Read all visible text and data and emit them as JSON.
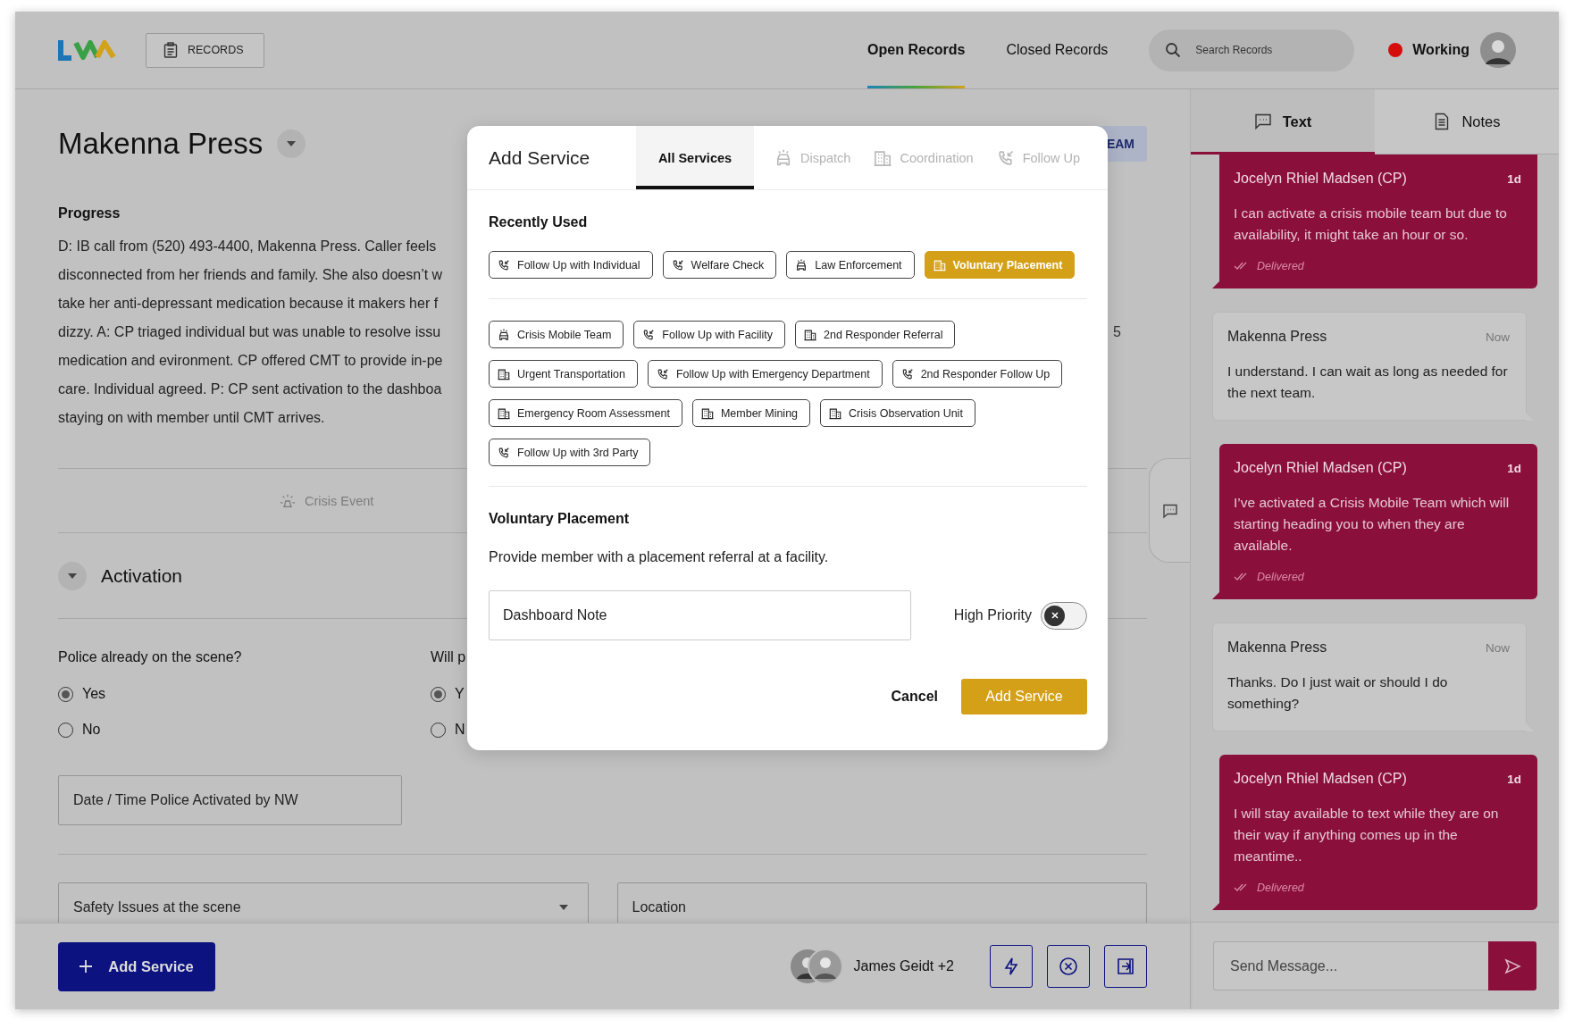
{
  "header": {
    "records_button": "RECORDS",
    "nav": [
      {
        "label": "Open Records",
        "selected": true
      },
      {
        "label": "Closed Records",
        "selected": false
      }
    ],
    "search": {
      "placeholder": "Search Records"
    },
    "status": "Working"
  },
  "record": {
    "title": "Makenna Press",
    "cut_button": "EAM",
    "progress": {
      "heading": "Progress",
      "lines": [
        "D: IB call from (520) 493-4400, Makenna Press. Caller feels",
        "disconnected from her friends and family. She also doesn’t w",
        "take her anti-depressant medication because it makers her f",
        "dizzy. A: CP triaged individual but was unable to resolve issu",
        "medication and evironment. CP offered CMT to provide in-pe",
        "care. Individual agreed. P:  CP sent activation to the dashboa",
        "staying on with member until CMT arrives."
      ],
      "fragment": "5"
    },
    "event_tab": "Crisis Event",
    "section": {
      "title": "Activation",
      "expanded": true
    },
    "questions": [
      {
        "label": "Police already on the scene?",
        "options": [
          {
            "label": "Yes",
            "selected": true
          },
          {
            "label": "No",
            "selected": false
          }
        ]
      },
      {
        "label": "Will p",
        "options": [
          {
            "label": "Y",
            "selected": true
          },
          {
            "label": "N",
            "selected": false
          }
        ]
      }
    ],
    "date_field": {
      "placeholder": "Date / Time Police Activated by NW"
    },
    "fields": [
      {
        "kind": "select",
        "placeholder": "Safety Issues at the scene"
      },
      {
        "kind": "text",
        "placeholder": "Location"
      }
    ]
  },
  "footer": {
    "add_button": "Add Service",
    "assignees": "James Geidt +2",
    "actions": [
      {
        "kind": "bolt"
      },
      {
        "kind": "cancel"
      },
      {
        "kind": "exit"
      }
    ]
  },
  "modal": {
    "title": "Add Service",
    "tabs": [
      {
        "label": "All Services",
        "selected": true
      },
      {
        "label": "Dispatch",
        "kind": "car",
        "selected": false
      },
      {
        "label": "Coordination",
        "kind": "building",
        "selected": false
      },
      {
        "label": "Follow Up",
        "kind": "phone",
        "selected": false
      }
    ],
    "recent_heading": "Recently Used",
    "recent": [
      {
        "label": "Follow Up with Individual",
        "kind": "phone",
        "selected": false
      },
      {
        "label": "Welfare Check",
        "kind": "phone",
        "selected": false
      },
      {
        "label": "Law Enforcement",
        "kind": "car",
        "selected": false
      },
      {
        "label": "Voluntary Placement",
        "kind": "building",
        "selected": true
      }
    ],
    "services": [
      {
        "label": "Crisis Mobile Team",
        "kind": "car",
        "selected": false
      },
      {
        "label": "Follow Up with Facility",
        "kind": "phone",
        "selected": false
      },
      {
        "label": "2nd Responder Referral",
        "kind": "building",
        "selected": false
      },
      {
        "label": "Urgent Transportation",
        "kind": "building",
        "selected": false
      },
      {
        "label": "Follow Up with Emergency Department",
        "kind": "phone",
        "selected": false
      },
      {
        "label": "2nd Responder Follow Up",
        "kind": "phone",
        "selected": false
      },
      {
        "label": "Emergency Room Assessment",
        "kind": "building",
        "selected": false
      },
      {
        "label": "Member Mining",
        "kind": "building",
        "selected": false
      },
      {
        "label": "Crisis Observation Unit",
        "kind": "building",
        "selected": false
      },
      {
        "label": "Follow Up with 3rd Party",
        "kind": "phone",
        "selected": false
      }
    ],
    "detail": {
      "title": "Voluntary Placement",
      "description": "Provide member with a placement referral at a facility.",
      "note": {
        "placeholder": "Dashboard Note"
      },
      "priority": {
        "label": "High Priority",
        "on": false
      }
    },
    "buttons": {
      "cancel": "Cancel",
      "confirm": "Add Service"
    }
  },
  "chat": {
    "tabs": [
      {
        "label": "Text",
        "kind": "chat",
        "selected": true
      },
      {
        "label": "Notes",
        "kind": "note",
        "selected": false
      }
    ],
    "messages": [
      {
        "kind": "agent",
        "sender": "Jocelyn Rhiel Madsen (CP)",
        "time": "1d",
        "text": "I can activate a crisis mobile team but due to availability, it might take an hour or so.",
        "status": "Delivered"
      },
      {
        "kind": "member",
        "sender": "Makenna Press",
        "time": "Now",
        "text": "I understand. I can wait as long as needed for the next team."
      },
      {
        "kind": "agent",
        "sender": "Jocelyn Rhiel Madsen (CP)",
        "time": "1d",
        "text": "I’ve activated a Crisis Mobile Team which will starting heading you to when they are available.",
        "status": "Delivered"
      },
      {
        "kind": "member",
        "sender": "Makenna Press",
        "time": "Now",
        "text": "Thanks. Do I just wait or should I do something?"
      },
      {
        "kind": "agent",
        "sender": "Jocelyn Rhiel Madsen (CP)",
        "time": "1d",
        "text": "I will stay available to text while they are on their way if anything comes up in the meantime..",
        "status": "Delivered"
      }
    ],
    "composer": {
      "placeholder": "Send Message..."
    }
  }
}
